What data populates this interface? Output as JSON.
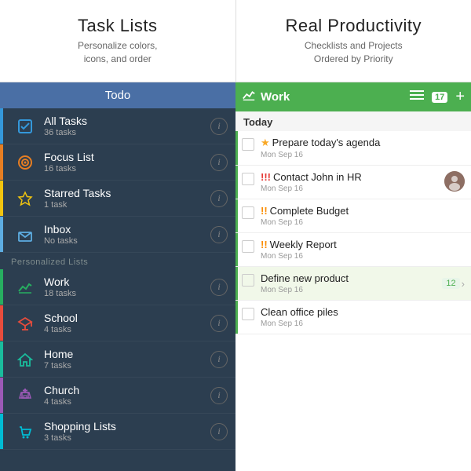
{
  "top": {
    "left": {
      "title": "Task Lists",
      "subtitle": "Personalize colors,\nicons, and order"
    },
    "right": {
      "title": "Real Productivity",
      "subtitle": "Checklists and Projects\nOrdered by Priority"
    }
  },
  "todo": {
    "header": "Todo",
    "items": [
      {
        "name": "All Tasks",
        "count": "36 tasks",
        "icon": "✓",
        "color": "blue",
        "type": "checkbox"
      },
      {
        "name": "Focus List",
        "count": "16 tasks",
        "icon": "◎",
        "color": "orange",
        "type": "circle"
      },
      {
        "name": "Starred Tasks",
        "count": "1 task",
        "icon": "☆",
        "color": "yellow",
        "type": "star"
      },
      {
        "name": "Inbox",
        "count": "No tasks",
        "icon": "✉",
        "color": "light-blue",
        "type": "inbox"
      }
    ],
    "section_label": "Personalized Lists",
    "personalized": [
      {
        "name": "Work",
        "count": "18 tasks",
        "icon": "📈",
        "color": "green",
        "type": "chart"
      },
      {
        "name": "School",
        "count": "4 tasks",
        "icon": "🎓",
        "color": "red",
        "type": "school"
      },
      {
        "name": "Home",
        "count": "7 tasks",
        "icon": "🏠",
        "color": "teal",
        "type": "home"
      },
      {
        "name": "Church",
        "count": "4 tasks",
        "icon": "⛪",
        "color": "purple",
        "type": "church"
      },
      {
        "name": "Shopping Lists",
        "count": "3 tasks",
        "icon": "🛒",
        "color": "cyan",
        "type": "shopping"
      }
    ]
  },
  "work": {
    "header": {
      "title": "Work",
      "calendar_day": "17",
      "icon": "📈"
    },
    "today_label": "Today",
    "tasks": [
      {
        "title": "Prepare today's agenda",
        "date": "Mon Sep 16",
        "priority": "star",
        "has_avatar": false,
        "badge": null
      },
      {
        "title": "Contact John in HR",
        "date": "Mon Sep 16",
        "priority": "high",
        "has_avatar": true,
        "badge": null
      },
      {
        "title": "Complete Budget",
        "date": "Mon Sep 16",
        "priority": "medium",
        "has_avatar": false,
        "badge": null
      },
      {
        "title": "Weekly Report",
        "date": "Mon Sep 16",
        "priority": "medium",
        "has_avatar": false,
        "badge": null
      },
      {
        "title": "Define new product",
        "date": "Mon Sep 16",
        "priority": "none",
        "has_avatar": false,
        "badge": "12"
      },
      {
        "title": "Clean office piles",
        "date": "Mon Sep 16",
        "priority": "none",
        "has_avatar": false,
        "badge": null
      }
    ]
  }
}
